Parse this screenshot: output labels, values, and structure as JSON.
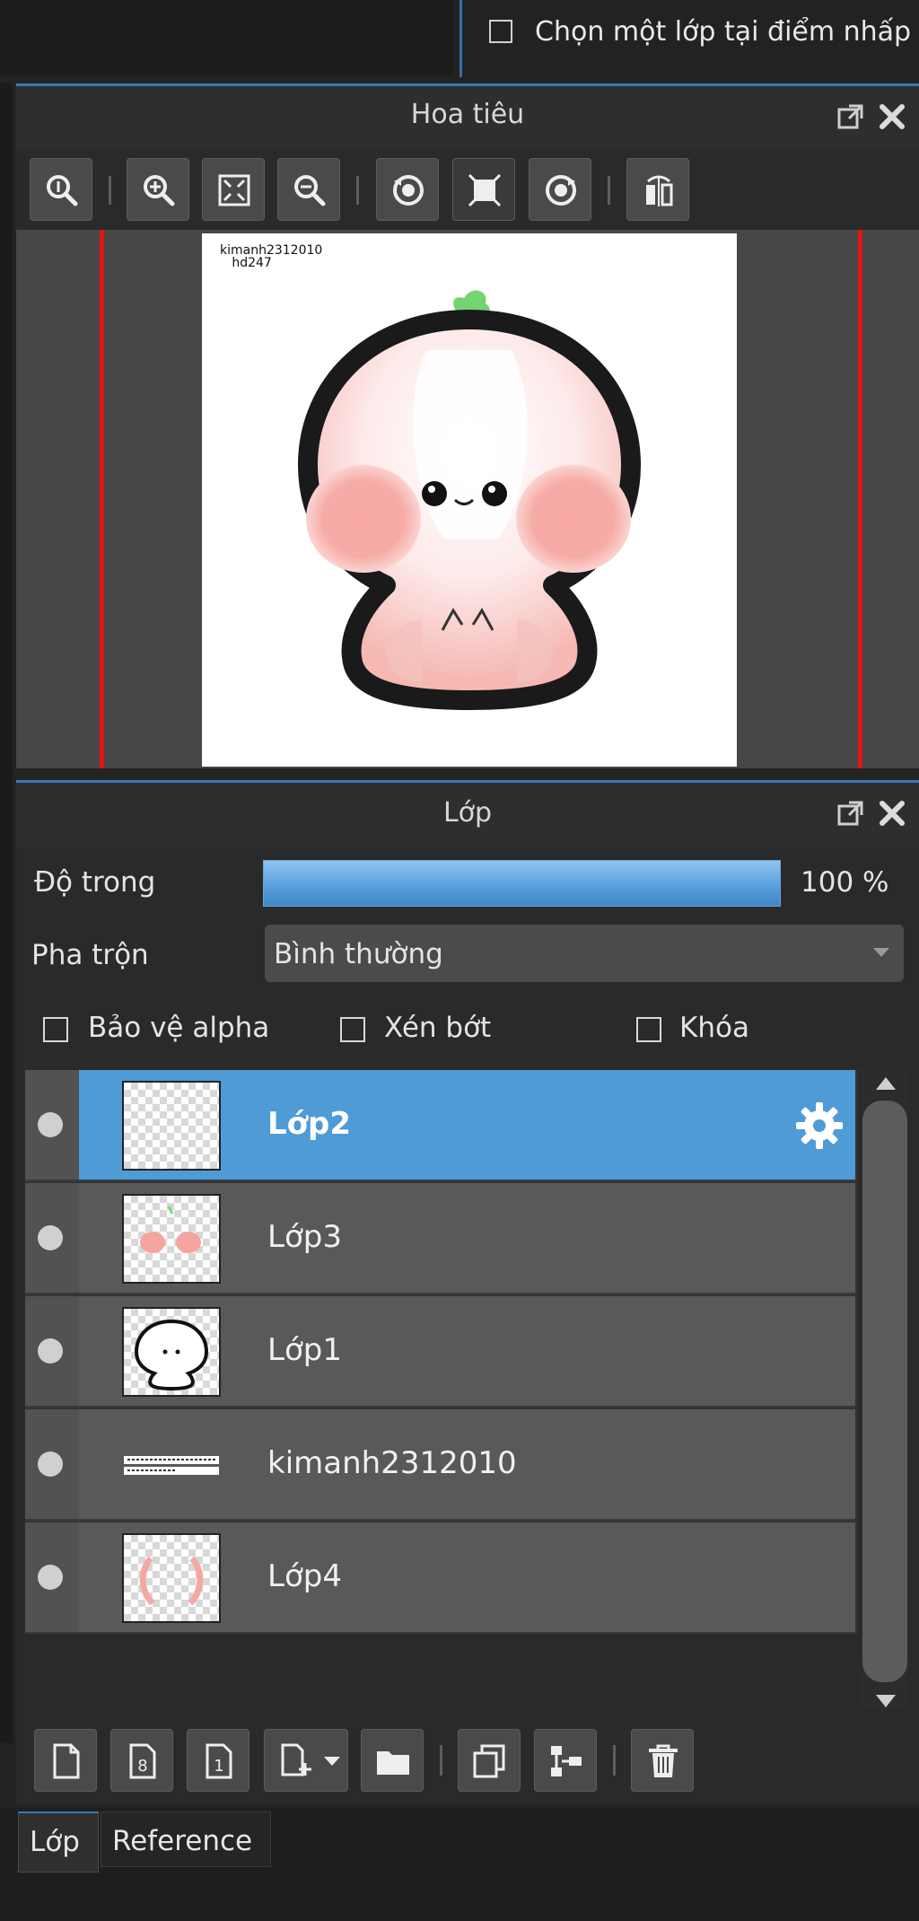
{
  "top_bar": {
    "select_layer_checkbox_label": "Chọn một lớp tại điểm nhấp",
    "select_layer_checked": false
  },
  "navigator": {
    "title": "Hoa tiêu",
    "canvas_caption_line1": "kimanh2312010",
    "canvas_caption_line2": "hd247",
    "toolbar_icons": [
      "zoom-actual-icon",
      "zoom-in-icon",
      "fit-window-icon",
      "zoom-out-icon",
      "rotate-left-icon",
      "reset-view-icon",
      "rotate-right-icon",
      "flip-horizontal-icon"
    ]
  },
  "layers_panel": {
    "title": "Lớp",
    "opacity_label": "Độ trong",
    "opacity_value": "100 %",
    "opacity_fraction": 1.0,
    "blend_label": "Pha trộn",
    "blend_value": "Bình thường",
    "protect_alpha_label": "Bảo vệ alpha",
    "clipping_label": "Xén bớt",
    "lock_label": "Khóa",
    "layers": [
      {
        "name": "Lớp2",
        "selected": true
      },
      {
        "name": "Lớp3",
        "selected": false
      },
      {
        "name": "Lớp1",
        "selected": false
      },
      {
        "name": "kimanh2312010",
        "selected": false
      },
      {
        "name": "Lớp4",
        "selected": false
      }
    ],
    "bottom_toolbar_icons": [
      "new-layer-icon",
      "new-8bit-layer-icon",
      "new-1bit-layer-icon",
      "add-layer-dropdown-icon",
      "new-folder-icon",
      "duplicate-layer-icon",
      "merge-layer-icon",
      "delete-layer-icon"
    ]
  },
  "tabs": {
    "layer_tab": "Lớp",
    "reference_tab": "Reference"
  },
  "colors": {
    "accent": "#4f9bd6",
    "guide_red": "#e01414",
    "panel_bg": "#2a2a2a"
  }
}
